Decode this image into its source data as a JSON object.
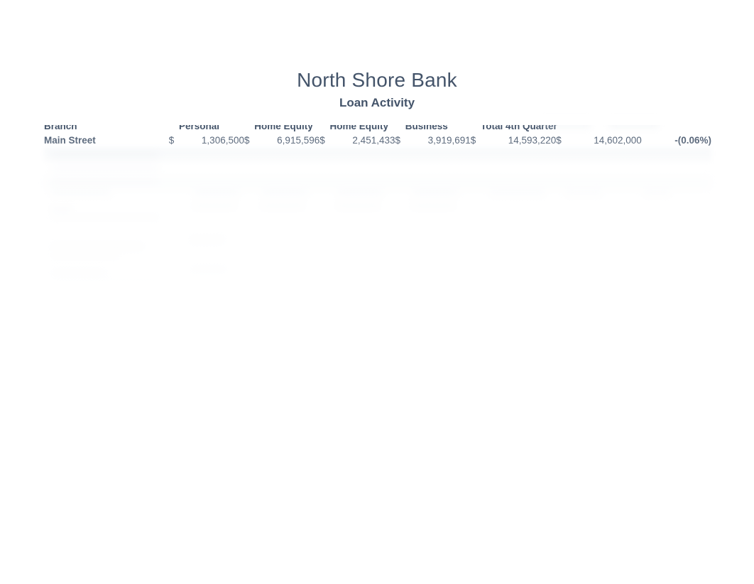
{
  "document": {
    "title": "North Shore Bank",
    "subtitle": "Loan Activity"
  },
  "table": {
    "headers": {
      "branch": "Branch",
      "personal": "Personal",
      "home_equity_1": "Home Equity",
      "home_equity_2": "Home Equity",
      "business": "Business",
      "total_4th_quarter": "Total 4th Quarter",
      "col7": "",
      "col8": ""
    },
    "currency_symbol": "$",
    "rows": [
      {
        "branch": "Main Street",
        "personal": "1,306,500",
        "home_equity_1": "6,915,596",
        "home_equity_2": "2,451,433",
        "business": "3,919,691",
        "total_4th_quarter": "14,593,220",
        "col7": "14,602,000",
        "variance_pct": "-(0.06%)"
      },
      {
        "branch": "",
        "personal": "",
        "home_equity_1": "",
        "home_equity_2": "",
        "business": "",
        "total_4th_quarter": "",
        "col7": "",
        "variance_pct": ""
      },
      {
        "branch": "",
        "personal": "",
        "home_equity_1": "",
        "home_equity_2": "",
        "business": "",
        "total_4th_quarter": "",
        "col7": "",
        "variance_pct": ""
      },
      {
        "branch": "",
        "personal": "",
        "home_equity_1": "",
        "home_equity_2": "",
        "business": "",
        "total_4th_quarter": "",
        "col7": "",
        "variance_pct": ""
      }
    ]
  },
  "colors": {
    "header_text": "#44546a",
    "negative_value": "#ff0000",
    "band_fill": "#eef2f6",
    "page_background": "#ffffff"
  }
}
